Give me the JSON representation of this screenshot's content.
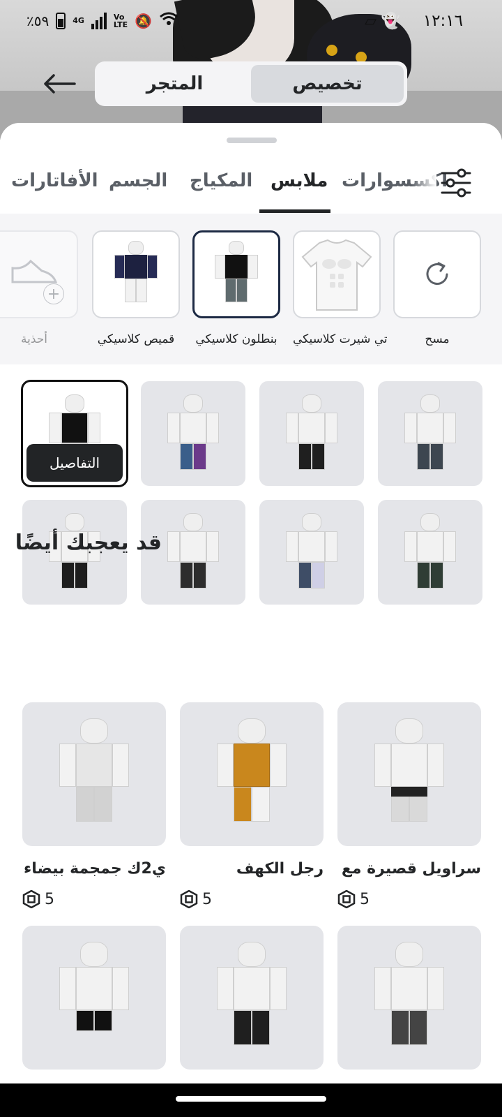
{
  "status_bar": {
    "time": "١٢:١٦",
    "battery": "٪٥٩",
    "network": "4G"
  },
  "top_tabs": {
    "customize": "تخصيص",
    "shop": "المتجر",
    "active": "customize"
  },
  "categories": [
    {
      "id": "accessories",
      "label": "اكسسوارات",
      "active": false
    },
    {
      "id": "clothing",
      "label": "ملابس",
      "active": true
    },
    {
      "id": "makeup",
      "label": "المكياج",
      "active": false
    },
    {
      "id": "body",
      "label": "الجسم",
      "active": false
    },
    {
      "id": "avatars",
      "label": "الأفاتارات",
      "active": false
    }
  ],
  "subcategories": [
    {
      "id": "clear",
      "label": "مسح",
      "icon": "refresh-icon",
      "selected": false
    },
    {
      "id": "tshirt",
      "label": "تي شيرت كلاسيكي",
      "selected": false
    },
    {
      "id": "pants",
      "label": "بنطلون كلاسيكي",
      "selected": true
    },
    {
      "id": "shirt",
      "label": "قميص كلاسيكي",
      "selected": false
    },
    {
      "id": "shoes",
      "label": "أحذية",
      "selected": false
    }
  ],
  "item_grid": {
    "details_label": "التفاصيل",
    "selected_index": 3
  },
  "recommendations": {
    "title": "قد يعجبك أيضًا",
    "currency_icon": "robux-icon",
    "items": [
      {
        "name": "سراويل قصيرة مع أ...",
        "price": "5"
      },
      {
        "name": "رجل الكهف",
        "price": "5"
      },
      {
        "name": "ي2ك جمجمة بيضاء",
        "price": "5"
      }
    ]
  },
  "colors": {
    "accent": "#232527",
    "selected_border": "#1d2a44",
    "tile_bg": "#e4e5e9"
  }
}
